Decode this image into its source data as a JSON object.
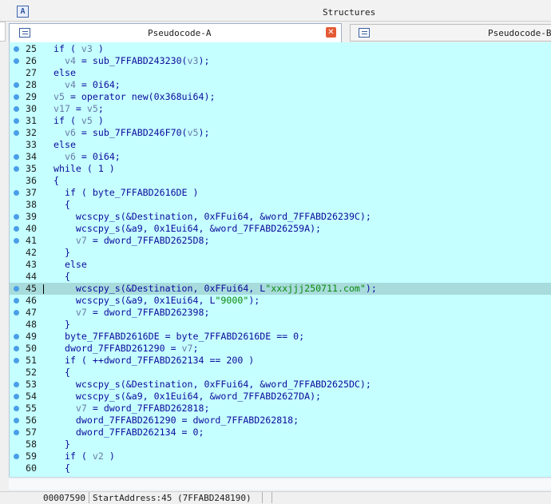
{
  "structures": {
    "title": "Structures",
    "icon": "structures-icon"
  },
  "tabs": [
    {
      "label": "Pseudocode-A",
      "icon": "pseudocode-icon",
      "close_icon": "close-icon",
      "active": true
    },
    {
      "label": "Pseudocode-B",
      "icon": "pseudocode-icon",
      "active": false
    }
  ],
  "status": {
    "offset": "00007590",
    "address": "StartAddress:45 (7FFABD248190)"
  },
  "colors": {
    "editor_bg": "#c5ffff",
    "highlight": "#a8dcdc",
    "breakpoint_dot": "#4a9ee8",
    "keyword": "#0b0b9c",
    "variable": "#6a7ca8",
    "string": "#0b8a0b"
  },
  "code": [
    {
      "n": "25",
      "dot": true,
      "parts": [
        [
          "k",
          "if ( "
        ],
        [
          "v",
          "v3"
        ],
        [
          "k",
          " )"
        ]
      ]
    },
    {
      "n": "26",
      "dot": true,
      "parts": [
        [
          "k",
          "  "
        ],
        [
          "v",
          "v4"
        ],
        [
          "k",
          " = sub_7FFABD243230("
        ],
        [
          "v",
          "v3"
        ],
        [
          "k",
          ");"
        ]
      ]
    },
    {
      "n": "27",
      "dot": false,
      "parts": [
        [
          "k",
          "else"
        ]
      ]
    },
    {
      "n": "28",
      "dot": true,
      "parts": [
        [
          "k",
          "  "
        ],
        [
          "v",
          "v4"
        ],
        [
          "k",
          " = 0i64;"
        ]
      ]
    },
    {
      "n": "29",
      "dot": true,
      "parts": [
        [
          "v",
          "v5"
        ],
        [
          "k",
          " = operator new(0x368ui64);"
        ]
      ]
    },
    {
      "n": "30",
      "dot": true,
      "parts": [
        [
          "v",
          "v17"
        ],
        [
          "k",
          " = "
        ],
        [
          "v",
          "v5"
        ],
        [
          "k",
          ";"
        ]
      ]
    },
    {
      "n": "31",
      "dot": true,
      "parts": [
        [
          "k",
          "if ( "
        ],
        [
          "v",
          "v5"
        ],
        [
          "k",
          " )"
        ]
      ]
    },
    {
      "n": "32",
      "dot": true,
      "parts": [
        [
          "k",
          "  "
        ],
        [
          "v",
          "v6"
        ],
        [
          "k",
          " = sub_7FFABD246F70("
        ],
        [
          "v",
          "v5"
        ],
        [
          "k",
          ");"
        ]
      ]
    },
    {
      "n": "33",
      "dot": false,
      "parts": [
        [
          "k",
          "else"
        ]
      ]
    },
    {
      "n": "34",
      "dot": true,
      "parts": [
        [
          "k",
          "  "
        ],
        [
          "v",
          "v6"
        ],
        [
          "k",
          " = 0i64;"
        ]
      ]
    },
    {
      "n": "35",
      "dot": true,
      "parts": [
        [
          "k",
          "while ( 1 )"
        ]
      ]
    },
    {
      "n": "36",
      "dot": false,
      "parts": [
        [
          "k",
          "{"
        ]
      ]
    },
    {
      "n": "37",
      "dot": true,
      "parts": [
        [
          "k",
          "  if ( byte_7FFABD2616DE )"
        ]
      ]
    },
    {
      "n": "38",
      "dot": false,
      "parts": [
        [
          "k",
          "  {"
        ]
      ]
    },
    {
      "n": "39",
      "dot": true,
      "parts": [
        [
          "k",
          "    wcscpy_s(&Destination, 0xFFui64, &word_7FFABD26239C);"
        ]
      ]
    },
    {
      "n": "40",
      "dot": true,
      "parts": [
        [
          "k",
          "    wcscpy_s(&a9, 0x1Eui64, &word_7FFABD26259A);"
        ]
      ]
    },
    {
      "n": "41",
      "dot": true,
      "parts": [
        [
          "k",
          "    "
        ],
        [
          "v",
          "v7"
        ],
        [
          "k",
          " = dword_7FFABD2625D8;"
        ]
      ]
    },
    {
      "n": "42",
      "dot": false,
      "parts": [
        [
          "k",
          "  }"
        ]
      ]
    },
    {
      "n": "43",
      "dot": false,
      "parts": [
        [
          "k",
          "  else"
        ]
      ]
    },
    {
      "n": "44",
      "dot": false,
      "parts": [
        [
          "k",
          "  {"
        ]
      ]
    },
    {
      "n": "45",
      "dot": true,
      "hl": true,
      "cursor": true,
      "parts": [
        [
          "k",
          "    wcscpy_s(&Destination, 0xFFui64, L"
        ],
        [
          "s",
          "\"xxxjjj250711.com\""
        ],
        [
          "k",
          ");"
        ]
      ]
    },
    {
      "n": "46",
      "dot": true,
      "parts": [
        [
          "k",
          "    wcscpy_s(&a9, 0x1Eui64, L"
        ],
        [
          "s",
          "\"9000\""
        ],
        [
          "k",
          ");"
        ]
      ]
    },
    {
      "n": "47",
      "dot": true,
      "parts": [
        [
          "k",
          "    "
        ],
        [
          "v",
          "v7"
        ],
        [
          "k",
          " = dword_7FFABD262398;"
        ]
      ]
    },
    {
      "n": "48",
      "dot": false,
      "parts": [
        [
          "k",
          "  }"
        ]
      ]
    },
    {
      "n": "49",
      "dot": true,
      "parts": [
        [
          "k",
          "  byte_7FFABD2616DE = byte_7FFABD2616DE == 0;"
        ]
      ]
    },
    {
      "n": "50",
      "dot": true,
      "parts": [
        [
          "k",
          "  dword_7FFABD261290 = "
        ],
        [
          "v",
          "v7"
        ],
        [
          "k",
          ";"
        ]
      ]
    },
    {
      "n": "51",
      "dot": true,
      "parts": [
        [
          "k",
          "  if ( ++dword_7FFABD262134 == 200 )"
        ]
      ]
    },
    {
      "n": "52",
      "dot": false,
      "parts": [
        [
          "k",
          "  {"
        ]
      ]
    },
    {
      "n": "53",
      "dot": true,
      "parts": [
        [
          "k",
          "    wcscpy_s(&Destination, 0xFFui64, &word_7FFABD2625DC);"
        ]
      ]
    },
    {
      "n": "54",
      "dot": true,
      "parts": [
        [
          "k",
          "    wcscpy_s(&a9, 0x1Eui64, &word_7FFABD2627DA);"
        ]
      ]
    },
    {
      "n": "55",
      "dot": true,
      "parts": [
        [
          "k",
          "    "
        ],
        [
          "v",
          "v7"
        ],
        [
          "k",
          " = dword_7FFABD262818;"
        ]
      ]
    },
    {
      "n": "56",
      "dot": true,
      "parts": [
        [
          "k",
          "    dword_7FFABD261290 = dword_7FFABD262818;"
        ]
      ]
    },
    {
      "n": "57",
      "dot": true,
      "parts": [
        [
          "k",
          "    dword_7FFABD262134 = 0;"
        ]
      ]
    },
    {
      "n": "58",
      "dot": false,
      "parts": [
        [
          "k",
          "  }"
        ]
      ]
    },
    {
      "n": "59",
      "dot": true,
      "parts": [
        [
          "k",
          "  if ( "
        ],
        [
          "v",
          "v2"
        ],
        [
          "k",
          " )"
        ]
      ]
    },
    {
      "n": "60",
      "dot": false,
      "parts": [
        [
          "k",
          "  {"
        ]
      ]
    }
  ]
}
